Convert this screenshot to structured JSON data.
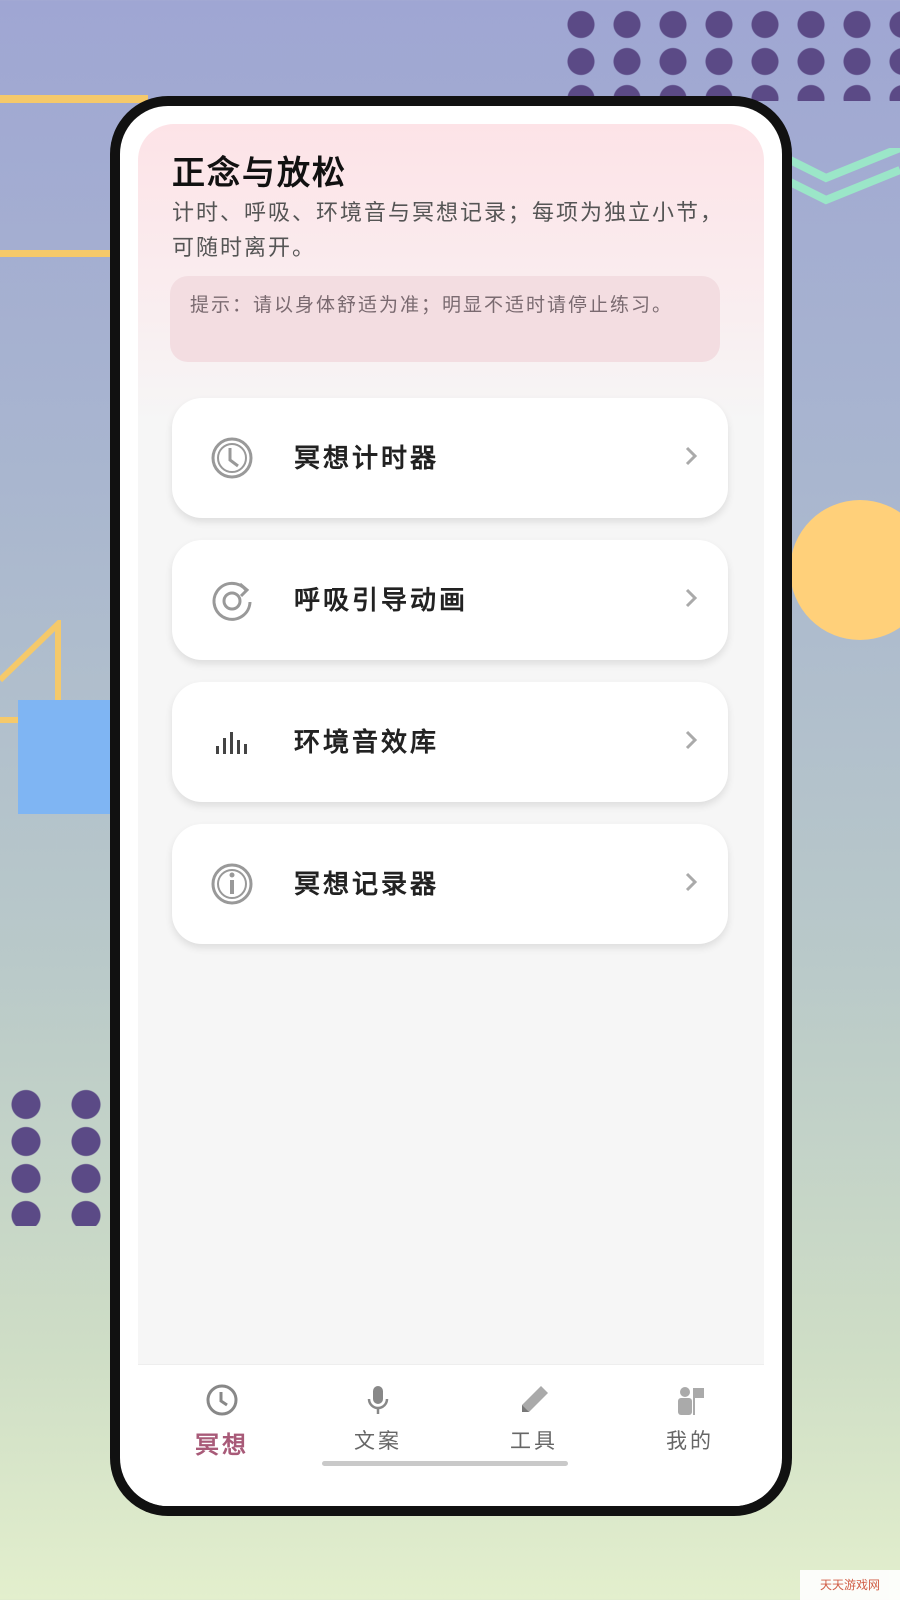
{
  "header": {
    "title": "正念与放松",
    "subtitle": "计时、呼吸、环境音与冥想记录；每项为独立小节，可随时离开。",
    "tip": "提示：请以身体舒适为准；明显不适时请停止练习。"
  },
  "features": [
    {
      "label": "冥想计时器",
      "icon": "clock-icon"
    },
    {
      "label": "呼吸引导动画",
      "icon": "refresh-icon"
    },
    {
      "label": "环境音效库",
      "icon": "sound-bars-icon"
    },
    {
      "label": "冥想记录器",
      "icon": "info-icon"
    }
  ],
  "tabs": [
    {
      "label": "冥想",
      "icon": "clock-icon",
      "active": true
    },
    {
      "label": "文案",
      "icon": "microphone-icon",
      "active": false
    },
    {
      "label": "工具",
      "icon": "pencil-icon",
      "active": false
    },
    {
      "label": "我的",
      "icon": "user-icon",
      "active": false
    }
  ],
  "colors": {
    "accent": "#a85a78",
    "header_bg": "#fde3e7",
    "tip_bg": "#f3dde1",
    "frame": "#111111"
  },
  "watermark": "天天游戏网"
}
